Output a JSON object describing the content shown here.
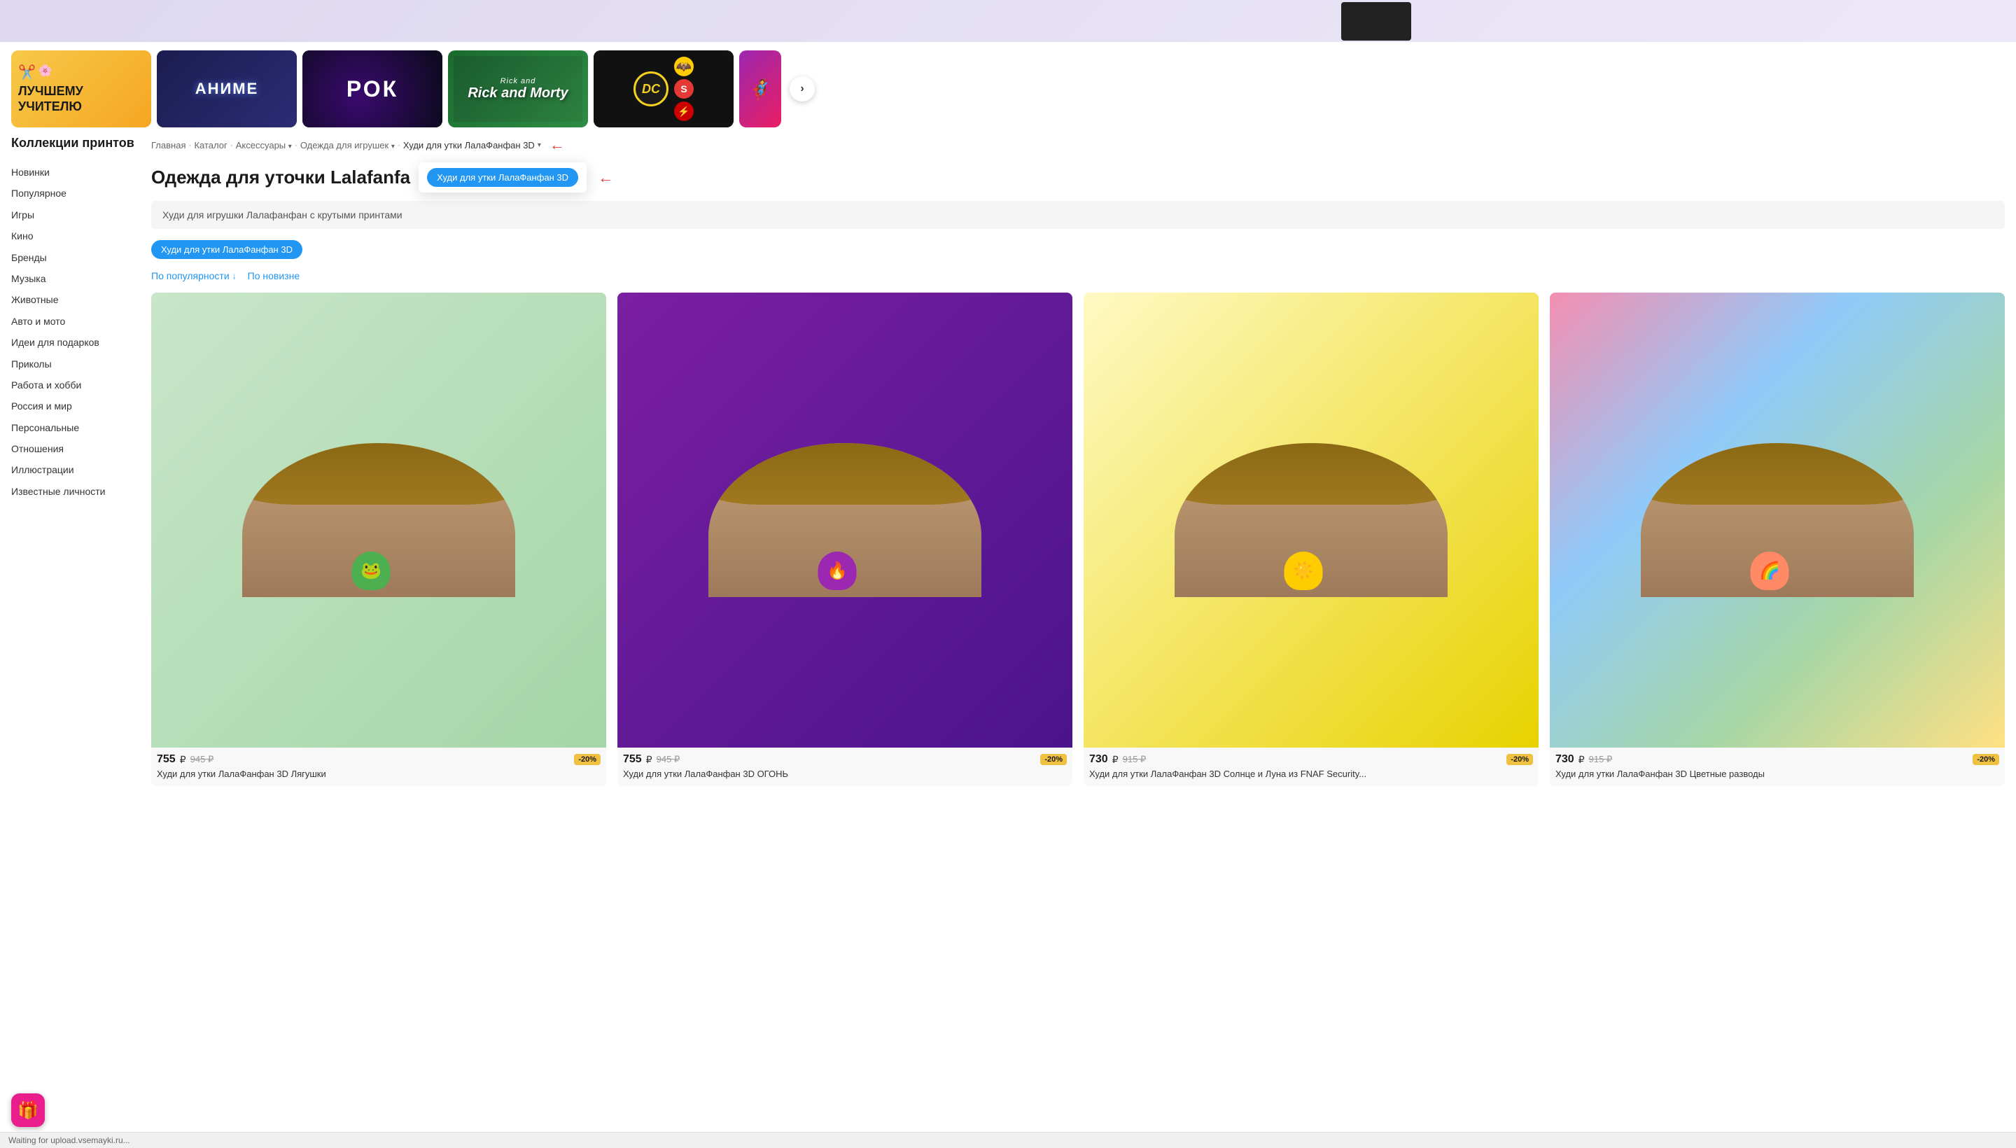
{
  "topBanner": {
    "alt": "decorative top banner with clothing item"
  },
  "categoryBanners": [
    {
      "id": "teacher",
      "label": "ЛУЧШЕМУ УЧИТЕЛЮ",
      "type": "teacher"
    },
    {
      "id": "anime",
      "label": "АНИМЕ",
      "type": "anime"
    },
    {
      "id": "rock",
      "label": "РОК",
      "type": "rock"
    },
    {
      "id": "rickmorty",
      "label": "Rick and Morty",
      "type": "rickmorty"
    },
    {
      "id": "dc",
      "label": "DC",
      "type": "dc"
    },
    {
      "id": "partial",
      "label": "",
      "type": "partial"
    }
  ],
  "navArrow": "›",
  "sidebar": {
    "title": "Коллекции принтов",
    "items": [
      "Новинки",
      "Популярное",
      "Игры",
      "Кино",
      "Бренды",
      "Музыка",
      "Животные",
      "Авто и мото",
      "Идеи для подарков",
      "Приколы",
      "Работа и хобби",
      "Россия и мир",
      "Персональные",
      "Отношения",
      "Иллюстрации",
      "Известные личности"
    ]
  },
  "breadcrumb": {
    "items": [
      "Главная",
      "Каталог",
      "Аксессуары",
      "Одежда для игрушек"
    ],
    "current": "Худи для утки ЛалаФанфан 3D",
    "separators": [
      "·",
      "·",
      "·",
      "·"
    ]
  },
  "pageTitle": "Одежда для уточки Lalafanfa",
  "dropdownLabel": "Худи для утки ЛалаФанфан 3D",
  "subtitle": "Худи для игрушки Лалафанфан с крутыми принтами",
  "filterChip": "Худи для утки ЛалаФанфан 3D",
  "sort": {
    "options": [
      {
        "label": "По популярности",
        "arrow": "↓",
        "active": true
      },
      {
        "label": "По новизне",
        "active": false
      }
    ]
  },
  "products": [
    {
      "name": "Худи для утки ЛалаФанфан 3D Лягушки",
      "priceCurrent": "755",
      "priceOld": "945 ₽",
      "discount": "-20%",
      "type": "green"
    },
    {
      "name": "Худи для утки ЛалаФанфан 3D ОГОНЬ",
      "priceCurrent": "755",
      "priceOld": "945 ₽",
      "discount": "-20%",
      "type": "purple"
    },
    {
      "name": "Худи для утки ЛалаФанфан 3D Солнце и Луна из FNAF Security...",
      "priceCurrent": "730",
      "priceOld": "915 ₽",
      "discount": "-20%",
      "type": "yellow"
    },
    {
      "name": "Худи для утки ЛалаФанфан 3D Цветные разводы",
      "priceCurrent": "730",
      "priceOld": "915 ₽",
      "discount": "-20%",
      "type": "multicolor"
    }
  ],
  "statusBar": "Waiting for upload.vsemayki.ru...",
  "giftIcon": "🎁",
  "currency": "₽"
}
